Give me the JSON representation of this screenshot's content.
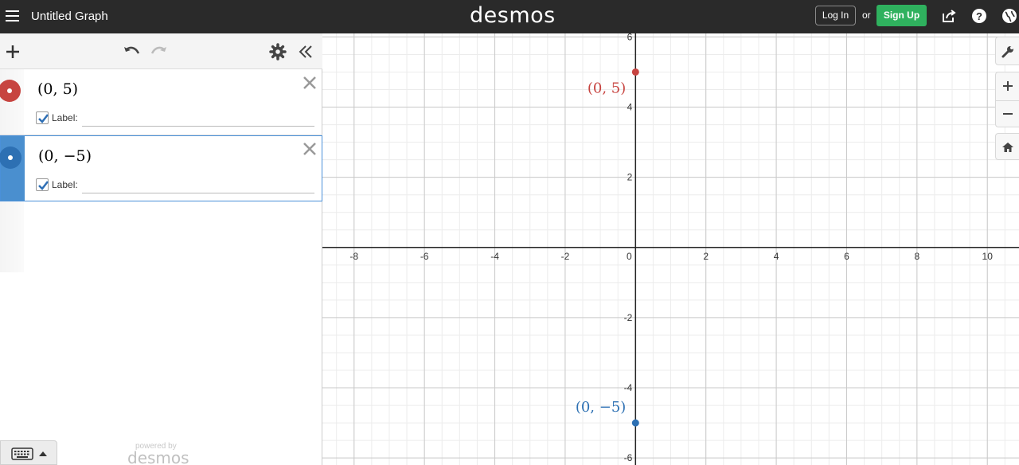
{
  "header": {
    "title": "Untitled Graph",
    "brand": "desmos",
    "login_label": "Log In",
    "or_text": "or",
    "signup_label": "Sign Up",
    "icons": [
      "menu-icon",
      "share-icon",
      "help-icon",
      "globe-icon"
    ]
  },
  "toolbar": {
    "icons": [
      "add-icon",
      "undo-icon",
      "redo-icon",
      "gear-icon",
      "collapse-icon"
    ]
  },
  "expressions": [
    {
      "latex": "(0, 5)",
      "color": "#c74440",
      "label_text": "Label:",
      "label_checked": true,
      "active": false
    },
    {
      "latex": "(0, −5)",
      "color": "#2d70b3",
      "label_text": "Label:",
      "label_checked": true,
      "active": true
    }
  ],
  "footer": {
    "powered_by": "powered by",
    "brand": "desmos",
    "keyboard_icon": "keyboard-icon"
  },
  "graph_tools": [
    "wrench-icon",
    "zoom-in-icon",
    "zoom-out-icon",
    "home-icon"
  ],
  "chart_data": {
    "type": "scatter",
    "xlim": [
      -8.9,
      10.9
    ],
    "ylim": [
      -6.2,
      6.1
    ],
    "x_ticks": [
      -8,
      -6,
      -4,
      -2,
      0,
      2,
      4,
      6,
      8,
      10
    ],
    "y_ticks": [
      6,
      4,
      2,
      -2,
      -4,
      -6
    ],
    "x_tick_labels": [
      "-8",
      "-6",
      "-4",
      "-2",
      "0",
      "2",
      "4",
      "6",
      "8",
      "10"
    ],
    "y_tick_labels": [
      "6",
      "4",
      "2",
      "-2",
      "-4",
      "-6"
    ],
    "grid": true,
    "points": [
      {
        "x": 0,
        "y": 5,
        "label": "(0, 5)",
        "color": "#c74440"
      },
      {
        "x": 0,
        "y": -5,
        "label": "(0, −5)",
        "color": "#2d70b3"
      }
    ]
  }
}
